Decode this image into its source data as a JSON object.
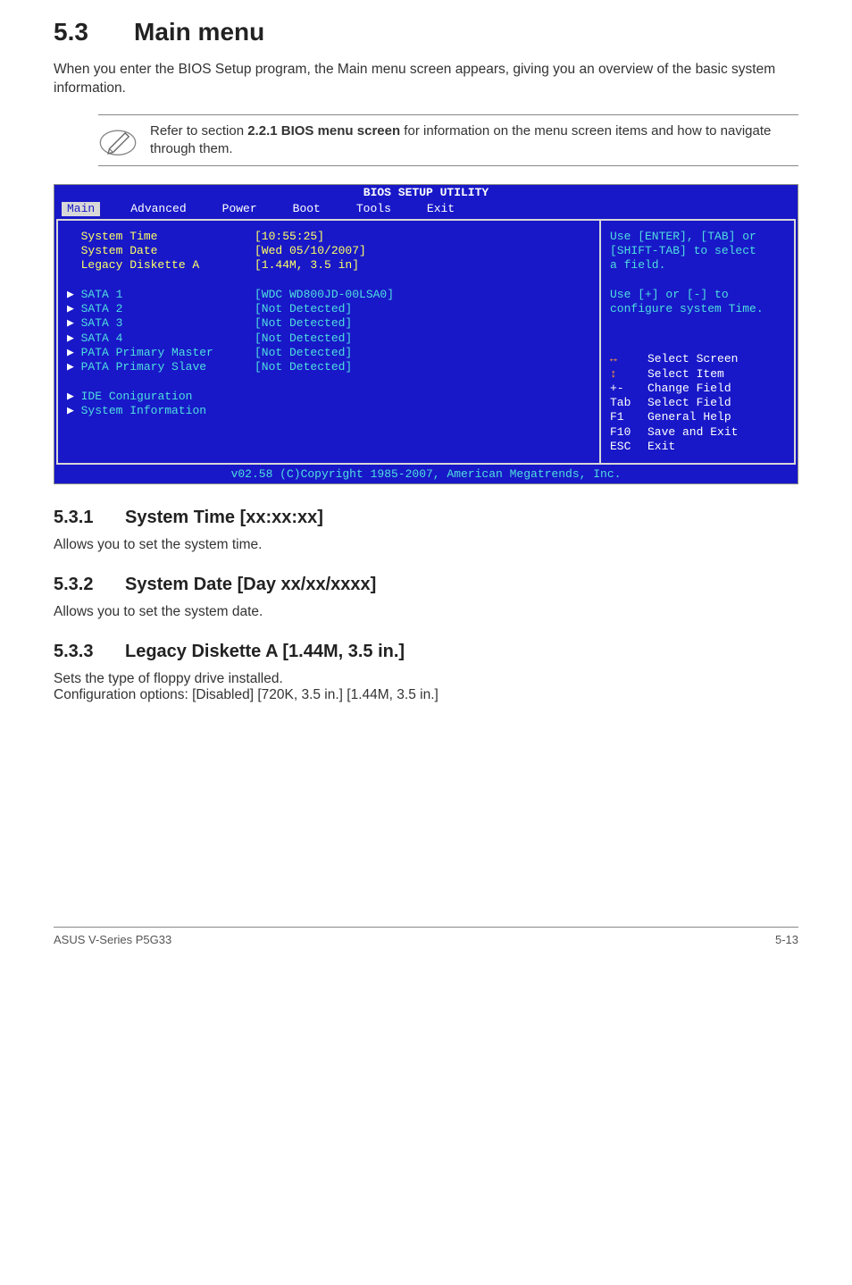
{
  "section": {
    "num": "5.3",
    "title": "Main menu"
  },
  "intro": "When you enter the BIOS Setup program, the Main menu screen appears, giving you an overview of the basic system information.",
  "note": {
    "pre": "Refer to section ",
    "bold": "2.2.1  BIOS menu screen",
    "post": " for information on the menu screen items and how to navigate through them."
  },
  "bios": {
    "title": "BIOS SETUP UTILITY",
    "tabs": [
      "Main",
      "Advanced",
      "Power",
      "Boot",
      "Tools",
      "Exit"
    ],
    "rows": [
      {
        "label": "System Time",
        "value": "[10:55:25]",
        "ptr": false,
        "cls": "yellow"
      },
      {
        "label": "System Date",
        "value": "[Wed 05/10/2007]",
        "ptr": false,
        "cls": "yellow"
      },
      {
        "label": "Legacy Diskette A",
        "value": "[1.44M, 3.5 in]",
        "ptr": false,
        "cls": "yellow"
      }
    ],
    "sata": [
      {
        "label": "SATA 1",
        "value": "[WDC WD800JD-00LSA0]"
      },
      {
        "label": "SATA 2",
        "value": "[Not Detected]"
      },
      {
        "label": "SATA 3",
        "value": "[Not Detected]"
      },
      {
        "label": "SATA 4",
        "value": "[Not Detected]"
      },
      {
        "label": "PATA Primary Master",
        "value": "[Not Detected]"
      },
      {
        "label": "PATA Primary Slave",
        "value": "[Not Detected]"
      }
    ],
    "ide": [
      "IDE Coniguration",
      "System Information"
    ],
    "help": [
      "Use [ENTER], [TAB] or",
      "[SHIFT-TAB] to select",
      "a field.",
      "",
      "Use [+] or [-] to",
      "configure system Time."
    ],
    "keys": [
      {
        "i": "↔",
        "k": "",
        "t": "Select Screen",
        "sel": true
      },
      {
        "i": "↕",
        "k": "",
        "t": "Select Item",
        "sel": true
      },
      {
        "k": "+-",
        "t": "Change Field"
      },
      {
        "k": "Tab",
        "t": "Select Field"
      },
      {
        "k": "F1",
        "t": "General Help"
      },
      {
        "k": "F10",
        "t": "Save and Exit"
      },
      {
        "k": "ESC",
        "t": "Exit"
      }
    ],
    "footer": "v02.58 (C)Copyright 1985-2007, American Megatrends, Inc."
  },
  "sub1": {
    "num": "5.3.1",
    "title": "System Time [xx:xx:xx]",
    "body": "Allows you to set the system time."
  },
  "sub2": {
    "num": "5.3.2",
    "title": "System Date [Day xx/xx/xxxx]",
    "body": "Allows you to set the system date."
  },
  "sub3": {
    "num": "5.3.3",
    "title": "Legacy Diskette A [1.44M, 3.5 in.]",
    "body1": "Sets the type of floppy drive installed.",
    "body2": "Configuration options: [Disabled] [720K, 3.5 in.] [1.44M, 3.5 in.]"
  },
  "footer": {
    "left": "ASUS V-Series P5G33",
    "right": "5-13"
  }
}
